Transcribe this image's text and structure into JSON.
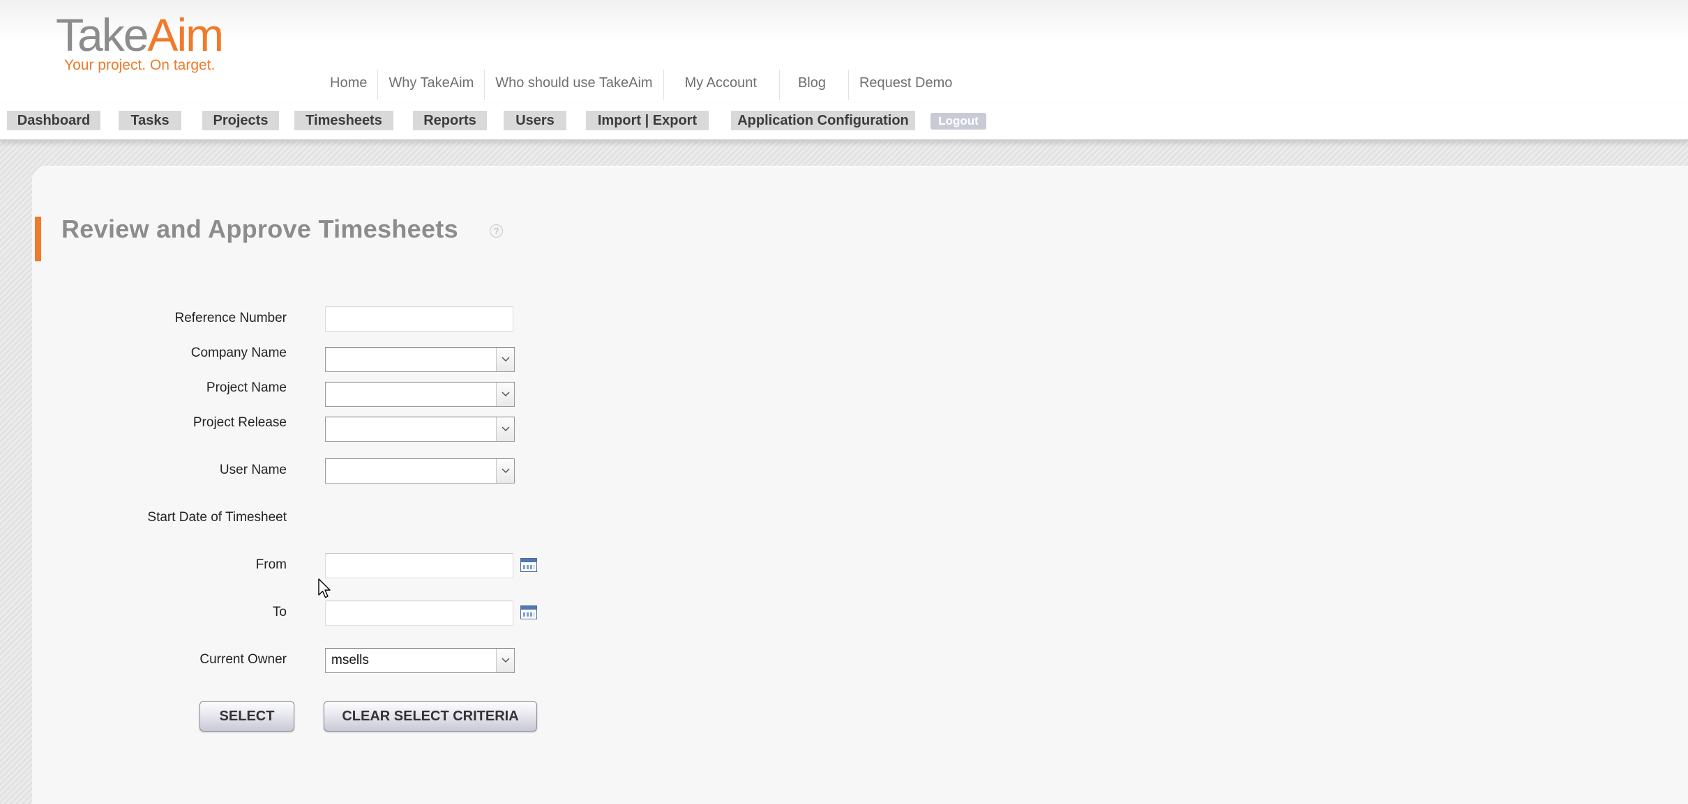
{
  "brand": {
    "logo_take": "Take",
    "logo_aim": "Aim",
    "tagline": "Your project. On target."
  },
  "top_nav": [
    "Home",
    "Why TakeAim",
    "Who should use TakeAim",
    "My Account",
    "Blog",
    "Request Demo"
  ],
  "menu": {
    "dashboard": "Dashboard",
    "tasks": "Tasks",
    "projects": "Projects",
    "timesheets": "Timesheets",
    "reports": "Reports",
    "users": "Users",
    "import_export": "Import | Export",
    "app_config": "Application Configuration",
    "logout": "Logout"
  },
  "page": {
    "title": "Review and Approve Timesheets",
    "help": "?"
  },
  "form": {
    "reference_number": {
      "label": "Reference Number",
      "value": ""
    },
    "company_name": {
      "label": "Company Name",
      "value": ""
    },
    "project_name": {
      "label": "Project Name",
      "value": ""
    },
    "project_release": {
      "label": "Project Release",
      "value": ""
    },
    "user_name": {
      "label": "User Name",
      "value": ""
    },
    "start_date_heading": "Start Date of Timesheet",
    "from": {
      "label": "From",
      "value": ""
    },
    "to": {
      "label": "To",
      "value": ""
    },
    "current_owner": {
      "label": "Current Owner",
      "value": "msells"
    }
  },
  "buttons": {
    "select": "SELECT",
    "clear": "CLEAR SELECT CRITERIA"
  },
  "colors": {
    "accent": "#f07a2a",
    "title_gray": "#8c8c8c"
  }
}
